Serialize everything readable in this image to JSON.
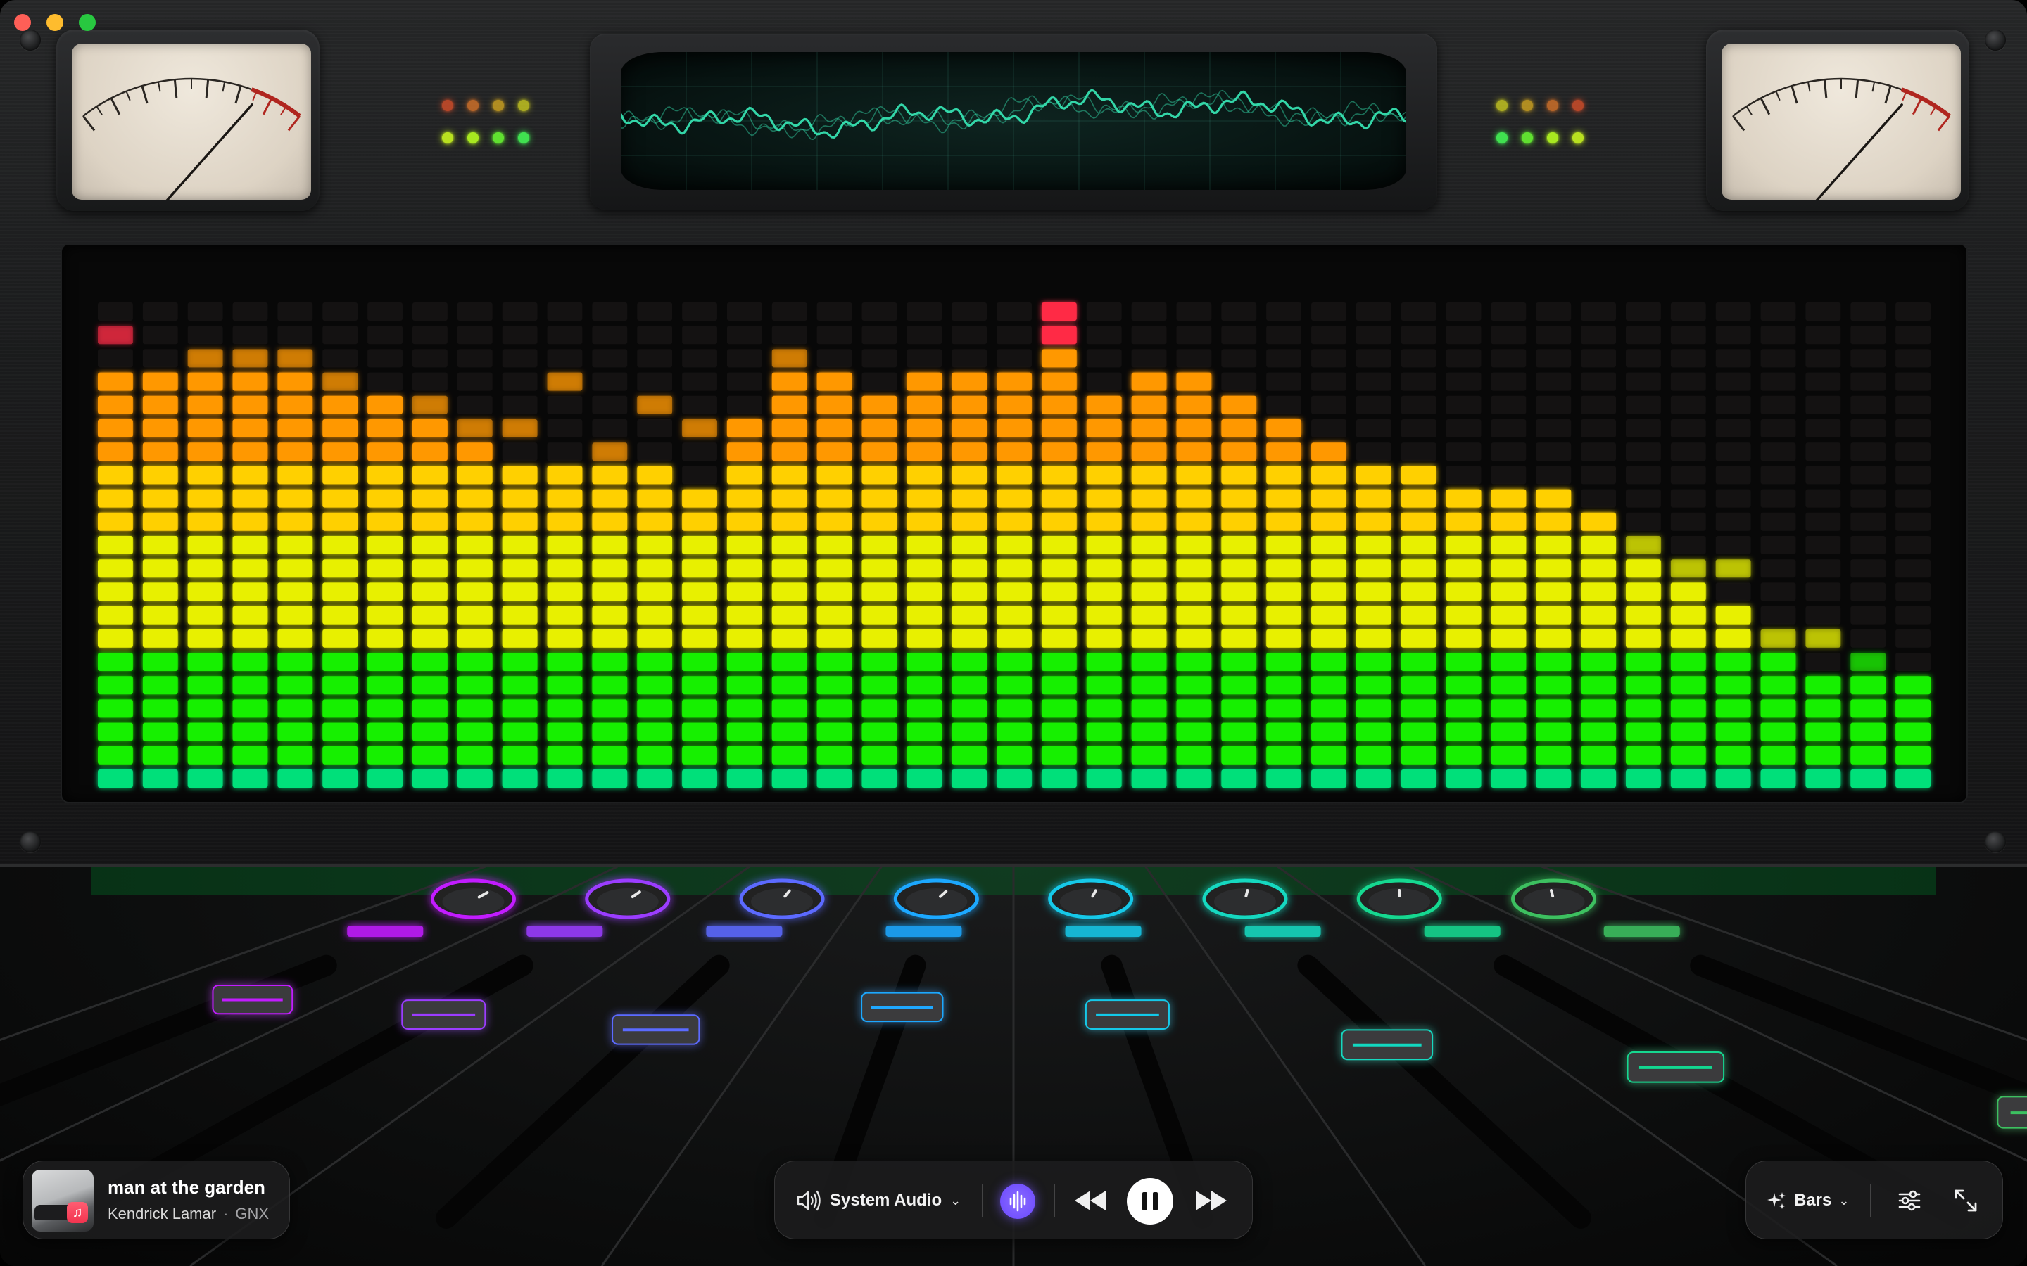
{
  "window": {
    "traffic_lights": [
      "close",
      "minimize",
      "zoom"
    ]
  },
  "now_playing": {
    "title": "man at the garden",
    "artist": "Kendrick Lamar",
    "separator": "·",
    "album": "GNX",
    "badge_icon": "apple-music-icon"
  },
  "transport": {
    "audio_source_label": "System Audio",
    "audio_source_icon": "speaker-wave-icon",
    "visualizer_icon": "waveform-icon",
    "rewind_icon": "rewind-icon",
    "play_state": "playing",
    "pause_icon": "pause-icon",
    "fast_forward_icon": "fast-forward-icon"
  },
  "viz_controls": {
    "mode_label": "Bars",
    "mode_icon": "sparkles-icon",
    "settings_icon": "sliders-icon",
    "expand_icon": "expand-arrows-icon"
  },
  "spectrum": {
    "segments_per_bar": 19,
    "levels": [
      18,
      18,
      18,
      18,
      18,
      17,
      17,
      16,
      15,
      14,
      14,
      14,
      14,
      13,
      16,
      18,
      18,
      17,
      18,
      18,
      18,
      21,
      17,
      18,
      18,
      17,
      16,
      15,
      14,
      14,
      13,
      13,
      13,
      12,
      10,
      9,
      8,
      6,
      5,
      5,
      5
    ],
    "peaks": [
      20,
      18,
      19,
      19,
      19,
      18,
      17,
      17,
      16,
      16,
      18,
      15,
      17,
      16,
      16,
      19,
      18,
      17,
      18,
      18,
      18,
      21,
      17,
      18,
      18,
      17,
      16,
      15,
      14,
      14,
      13,
      13,
      13,
      12,
      11,
      10,
      10,
      7,
      7,
      6,
      5
    ],
    "colors": {
      "bottom": "#00e07a",
      "green": "#19f000",
      "yellow": "#e8f000",
      "gold": "#ffd000",
      "orange": "#ff9800",
      "red": "#ff2a45"
    }
  },
  "mixer": {
    "channel_colors": [
      "#c21cff",
      "#9b3cff",
      "#5b6bff",
      "#1fa8ff",
      "#12c8e8",
      "#12d8c0",
      "#12d890",
      "#3cc060"
    ],
    "fader_levels": [
      0.92,
      0.88,
      0.84,
      0.9,
      0.88,
      0.8,
      0.74,
      0.62
    ],
    "knob_levels": [
      0.8,
      0.75,
      0.65,
      0.7,
      0.6,
      0.55,
      0.5,
      0.45
    ]
  },
  "scope": {
    "trace_color": "#36e0b0"
  },
  "leds_left": {
    "row1": [
      "#e5522a",
      "#e57a2a",
      "#e0b020",
      "#d8d820"
    ],
    "row2": [
      "#b8e020",
      "#a8e820",
      "#60e030",
      "#40e050"
    ]
  },
  "leds_right": {
    "row1": [
      "#d8d820",
      "#e0b020",
      "#e57a2a",
      "#e5522a"
    ],
    "row2": [
      "#40e050",
      "#60e030",
      "#a8e820",
      "#b8e020"
    ]
  }
}
